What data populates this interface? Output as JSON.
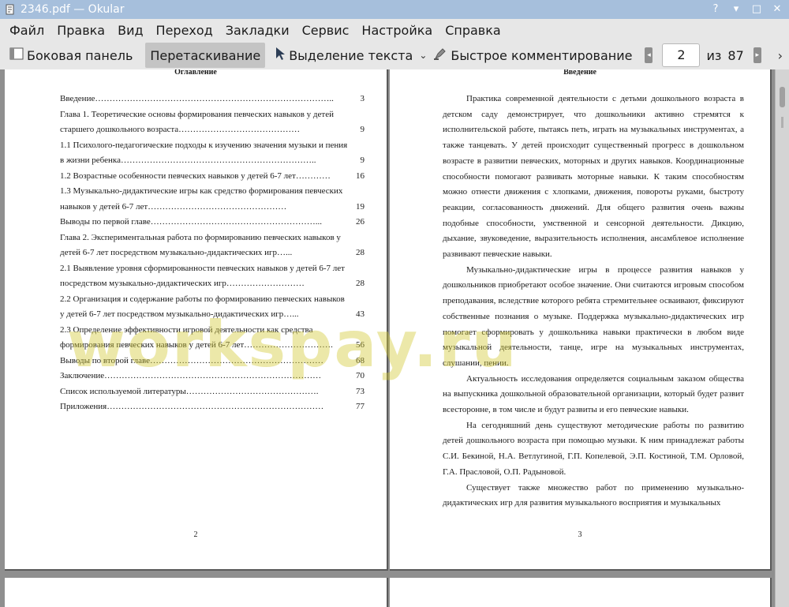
{
  "window": {
    "title": "2346.pdf — Okular",
    "controls": [
      "?",
      "▾",
      "□",
      "✕"
    ]
  },
  "menu": [
    "Файл",
    "Правка",
    "Вид",
    "Переход",
    "Закладки",
    "Сервис",
    "Настройка",
    "Справка"
  ],
  "toolbar": {
    "sidebar": "Боковая панель",
    "drag": "Перетаскивание",
    "select_text": "Выделение текста",
    "quick_comment": "Быстрое комментирование",
    "page_current": "2",
    "of_label": "из",
    "page_total": "87"
  },
  "left_page": {
    "heading": "Оглавление",
    "toc": [
      {
        "title": "Введение………………………………………………………………………..",
        "page": "3"
      },
      {
        "title": "Глава 1. Теоретические основы формирования певческих навыков у детей старшего дошкольного возраста……………………………………",
        "page": "9"
      },
      {
        "title": "1.1 Психолого-педагогические подходы к изучению значения музыки и пения в жизни ребенка…………………………………………………………..",
        "page": "9"
      },
      {
        "title": "1.2 Возрастные особенности певческих навыков у детей 6-7 лет…………",
        "page": "16"
      },
      {
        "title": "1.3 Музыкально-дидактические игры как средство формирования певческих навыков у детей 6-7 лет…………………………………………",
        "page": "19"
      },
      {
        "title": "Выводы по первой главе…………………………………………………...",
        "page": "26"
      },
      {
        "title": "Глава 2. Экспериментальная работа по формированию певческих навыков у детей 6-7 лет посредством музыкально-дидактических игр…...",
        "page": "28"
      },
      {
        "title": "2.1 Выявление уровня сформированности певческих навыков у детей 6-7 лет посредством музыкально-дидактических игр………………………",
        "page": "28"
      },
      {
        "title": "2.2 Организация и содержание работы по формированию певческих навыков у детей 6-7 лет посредством музыкально-дидактических игр…...",
        "page": "43"
      },
      {
        "title": "2.3 Определение эффективности игровой деятельности как средства формирования певческих навыков у детей 6-7 лет………………………….",
        "page": "56"
      },
      {
        "title": "Выводы по второй главе……………………………………………………",
        "page": "68"
      },
      {
        "title": "Заключение…………………………………………………………………",
        "page": "70"
      },
      {
        "title": "Список используемой литературы……………………………………….",
        "page": "73"
      },
      {
        "title": "Приложения…………………………………………………………………",
        "page": "77"
      }
    ],
    "page_number": "2"
  },
  "right_page": {
    "heading": "Введение",
    "paragraphs": [
      "Практика современной деятельности с детьми дошкольного возраста в детском саду демонстрирует, что дошкольники активно стремятся к исполнительской работе, пытаясь петь, играть на музыкальных инструментах, а также танцевать. У детей происходит существенный прогресс в дошкольном возрасте в развитии певческих, моторных и других навыков. Координационные способности помогают развивать моторные навыки. К таким способностям можно отнести движения с хлопками, движения, повороты руками, быстроту реакции, согласованность движений. Для общего развития очень важны подобные способности, умственной и сенсорной деятельности. Дикцию, дыхание, звуковедение, выразительность исполнения, ансамблевое исполнение развивают певческие навыки.",
      "Музыкально-дидактические игры в процессе развития навыков у дошкольников приобретают особое значение. Они считаются игровым способом преподавания, вследствие которого ребята стремительнее осваивают, фиксируют собственные познания о музыке. Поддержка музыкально-дидактических игр помогает сформировать у дошкольника навыки практически в любом виде музыкальной деятельности, танце, игре на музыкальных инструментах, слушании, пении.",
      "Актуальность исследования определяется социальным заказом общества на выпускника дошкольной образовательной организации, который будет развит всесторонне, в том числе и будут развиты и его певческие навыки.",
      "На сегодняшний день существуют методические работы по развитию детей дошкольного возраста при помощью музыки. К ним принадлежат работы С.И. Бекиной, Н.А. Ветлугиной, Г.П. Копелевой, Э.П. Костиной, Т.М. Орловой, Г.А. Прасловой, О.П. Радыновой.",
      "Существует также множество работ по применению музыкально-дидактических игр для развития музыкального восприятия и музыкальных"
    ],
    "page_number": "3"
  },
  "watermark": "workspay.ru"
}
